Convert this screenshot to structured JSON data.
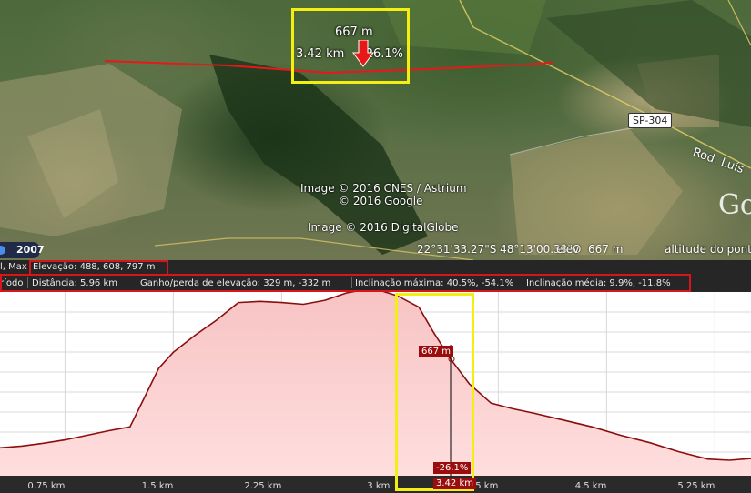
{
  "map": {
    "attribution_cnes": "Image © 2016 CNES / Astrium",
    "attribution_google": "© 2016 Google",
    "attribution_digitalglobe": "Image © 2016 DigitalGlobe",
    "google_wordmark": "Go",
    "road_shield": "SP-304",
    "road_name": "Rod. Luís",
    "year": "2007",
    "coordinates": "22°31'33.27\"S  48°13'00.33\"O",
    "elev_label": "elev",
    "elev_value": "667 m",
    "eye_alt_label": "altitude do ponto",
    "callout": {
      "elevation": "667 m",
      "distance": "3.42 km",
      "slope": "-26.1%"
    }
  },
  "info": {
    "min_max_label": "l, Max",
    "elevation": "Elevação: 488, 608, 797 m",
    "period": "ríodo",
    "distance": "Distância: 5.96 km",
    "gain_loss": "Ganho/perda de elevação: 329 m, -332 m",
    "max_slope": "Inclinação máxima: 40.5%, -54.1%",
    "avg_slope": "Inclinação média: 9.9%, -11.8%"
  },
  "chart_data": {
    "type": "area",
    "title": "",
    "xlabel": "",
    "ylabel": "",
    "x_unit": "km",
    "x_ticks": [
      "0.75 km",
      "1.5 km",
      "2.25 km",
      "3 km",
      "3.75 km",
      "4.5 km",
      "5.25 km"
    ],
    "x_tick_values": [
      0.75,
      1.5,
      2.25,
      3.0,
      3.75,
      4.5,
      5.25
    ],
    "xlim": [
      0.3,
      5.5
    ],
    "ylim": [
      488,
      797
    ],
    "series": [
      {
        "x": [
          0.3,
          0.45,
          0.6,
          0.75,
          0.9,
          1.05,
          1.2,
          1.3,
          1.4,
          1.5,
          1.65,
          1.8,
          1.95,
          2.1,
          2.25,
          2.4,
          2.55,
          2.7,
          2.85,
          2.95,
          3.05,
          3.2,
          3.3,
          3.42,
          3.55,
          3.7,
          3.85,
          4.0,
          4.2,
          4.4,
          4.6,
          4.8,
          5.0,
          5.2,
          5.35,
          5.5
        ],
        "y": [
          531,
          534,
          539,
          545,
          553,
          561,
          568,
          620,
          672,
          700,
          730,
          757,
          788,
          790,
          788,
          785,
          792,
          805,
          812,
          808,
          800,
          780,
          736,
          688,
          644,
          610,
          600,
          592,
          580,
          568,
          553,
          540,
          524,
          511,
          509,
          512
        ]
      }
    ],
    "cursor": {
      "x": 3.42,
      "elevation_label": "667 m",
      "distance_label": "3.42 km",
      "slope_label": "-26.1%"
    },
    "colors": {
      "line": "#8b0d0d",
      "fill_top": "#f7c3c3",
      "fill_bottom": "#ffdede",
      "grid": "#d8d8d8",
      "axis_bar": "#2a2a2a"
    }
  }
}
